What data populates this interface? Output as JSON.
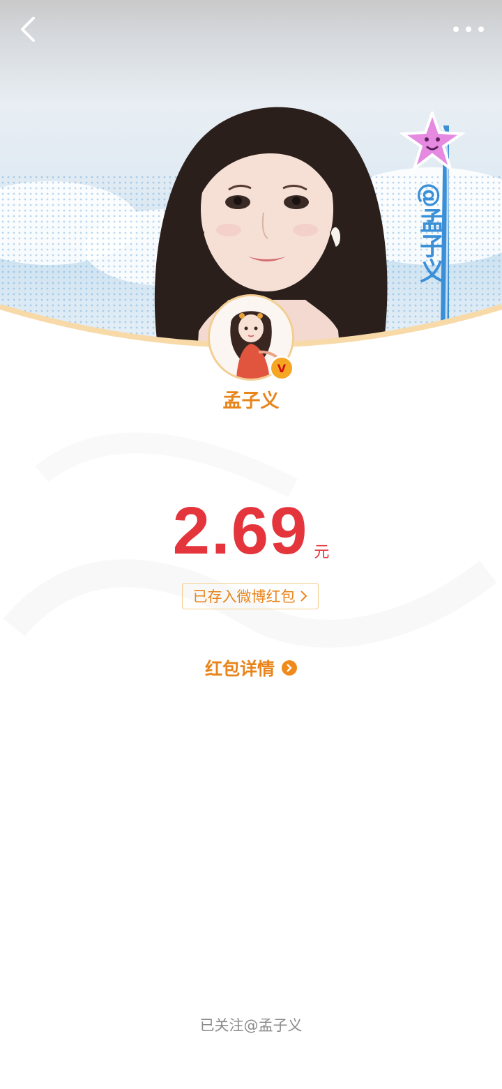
{
  "header": {
    "back_icon": "chevron-left-icon",
    "more_icon": "more-dots-icon"
  },
  "banner": {
    "tag_text": "@孟子义",
    "sticker": "star-sticker"
  },
  "profile": {
    "username": "孟子义",
    "verified_badge": "V"
  },
  "red_packet": {
    "amount": "2.69",
    "unit": "元",
    "deposit_label": "已存入微博红包",
    "details_label": "红包详情"
  },
  "footer": {
    "follow_status": "已关注@孟子义"
  },
  "colors": {
    "accent_orange": "#e8841a",
    "amount_red": "#e4343c",
    "border_gold": "#f2cf8c",
    "muted_gray": "#8a8a8a"
  }
}
